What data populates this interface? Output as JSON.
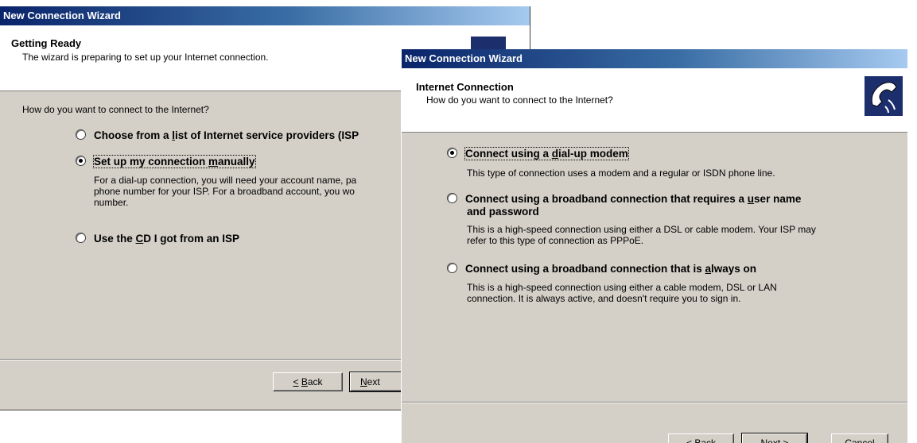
{
  "back_window": {
    "title": "New Connection Wizard",
    "header_title": "Getting Ready",
    "header_subtitle": "The wizard is preparing to set up your Internet connection.",
    "question": "How do you want to connect to the Internet?",
    "options": [
      {
        "label": "Choose from a list of Internet service providers (ISP",
        "selected": false
      },
      {
        "label": "Set up my connection manually",
        "selected": true
      },
      {
        "label": "Use the CD I got from an ISP",
        "selected": false
      }
    ],
    "manual_desc_line1": "For a dial-up connection, you will need your account name, pa",
    "manual_desc_line2": "phone number for your ISP. For a broadband account, you wo",
    "manual_desc_line3": "number.",
    "back_button": "< Back",
    "next_button": "Next"
  },
  "front_window": {
    "title": "New Connection Wizard",
    "header_title": "Internet Connection",
    "header_subtitle": "How do you want to connect to the Internet?",
    "icon": "phone-connection-icon",
    "options": [
      {
        "label": "Connect using a dial-up modem",
        "selected": true,
        "desc": [
          "This type of connection uses a modem and a regular or ISDN phone line."
        ]
      },
      {
        "label_line1": "Connect using a broadband connection that requires a user name",
        "label_line2": "and password",
        "selected": false,
        "desc": [
          "This is a high-speed connection using either a DSL or cable modem. Your ISP may",
          "refer to this type of connection as PPPoE."
        ]
      },
      {
        "label": "Connect using a broadband connection that is always on",
        "selected": false,
        "desc": [
          "This is a high-speed connection using either a cable modem, DSL or LAN",
          "connection. It is always active, and doesn't require you to sign in."
        ]
      }
    ],
    "back_button": "< Back",
    "next_button": "Next >",
    "cancel_button": "Cancel"
  }
}
